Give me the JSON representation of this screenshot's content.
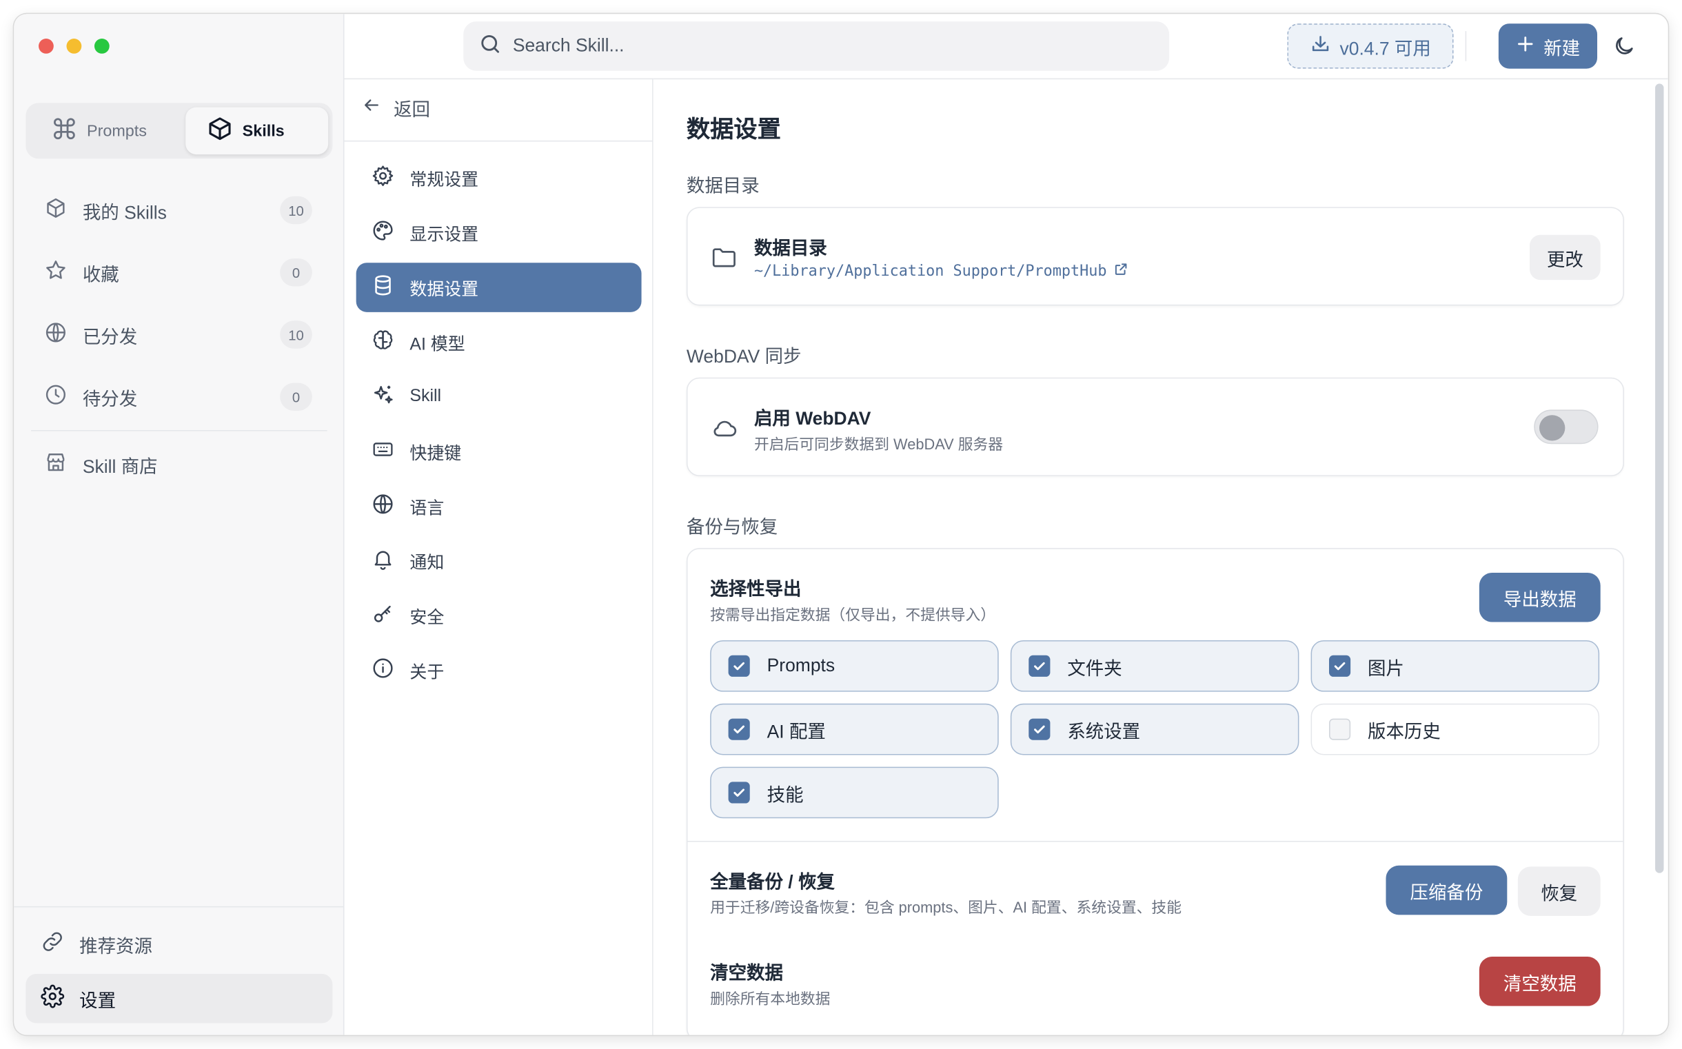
{
  "colors": {
    "accent": "#5477a7",
    "danger": "#b84444",
    "traffic_red": "#ed5f57",
    "traffic_yellow": "#f5bd2f",
    "traffic_green": "#28c840"
  },
  "sidebar": {
    "segment": [
      {
        "label": "Prompts",
        "icon": "command-icon",
        "active": false
      },
      {
        "label": "Skills",
        "icon": "cube-icon",
        "active": true
      }
    ],
    "items": [
      {
        "label": "我的 Skills",
        "count": "10",
        "icon": "cube-icon"
      },
      {
        "label": "收藏",
        "count": "0",
        "icon": "star-icon"
      },
      {
        "label": "已分发",
        "count": "10",
        "icon": "globe-icon"
      },
      {
        "label": "待分发",
        "count": "0",
        "icon": "clock-icon"
      }
    ],
    "store": {
      "label": "Skill 商店",
      "icon": "store-icon"
    },
    "bottom": [
      {
        "label": "推荐资源",
        "icon": "link-icon"
      },
      {
        "label": "设置",
        "icon": "gear-icon",
        "active": true
      }
    ]
  },
  "topbar": {
    "search_placeholder": "Search Skill...",
    "version_label": "v0.4.7 可用",
    "new_label": "新建"
  },
  "settings_menu": {
    "back_label": "返回",
    "items": [
      {
        "label": "常规设置",
        "icon": "gear-icon"
      },
      {
        "label": "显示设置",
        "icon": "palette-icon"
      },
      {
        "label": "数据设置",
        "icon": "database-icon",
        "active": true
      },
      {
        "label": "AI 模型",
        "icon": "brain-icon"
      },
      {
        "label": "Skill",
        "icon": "sparkles-icon"
      },
      {
        "label": "快捷键",
        "icon": "keyboard-icon"
      },
      {
        "label": "语言",
        "icon": "globe-icon"
      },
      {
        "label": "通知",
        "icon": "bell-icon"
      },
      {
        "label": "安全",
        "icon": "key-icon"
      },
      {
        "label": "关于",
        "icon": "info-icon"
      }
    ]
  },
  "content": {
    "page_title": "数据设置",
    "data_dir": {
      "section_title": "数据目录",
      "row_title": "数据目录",
      "path": "~/Library/Application Support/PromptHub",
      "change_label": "更改"
    },
    "webdav": {
      "section_title": "WebDAV 同步",
      "row_title": "启用 WebDAV",
      "row_desc": "开启后可同步数据到 WebDAV 服务器",
      "enabled": false
    },
    "backup": {
      "section_title": "备份与恢复",
      "selective": {
        "title": "选择性导出",
        "desc": "按需导出指定数据（仅导出，不提供导入）",
        "export_label": "导出数据",
        "options": [
          {
            "label": "Prompts",
            "checked": true
          },
          {
            "label": "文件夹",
            "checked": true
          },
          {
            "label": "图片",
            "checked": true
          },
          {
            "label": "AI 配置",
            "checked": true
          },
          {
            "label": "系统设置",
            "checked": true
          },
          {
            "label": "版本历史",
            "checked": false
          },
          {
            "label": "技能",
            "checked": true
          }
        ]
      },
      "full": {
        "title": "全量备份 / 恢复",
        "desc": "用于迁移/跨设备恢复：包含 prompts、图片、AI 配置、系统设置、技能",
        "backup_label": "压缩备份",
        "restore_label": "恢复"
      },
      "clear": {
        "title": "清空数据",
        "desc": "删除所有本地数据",
        "clear_label": "清空数据"
      }
    }
  }
}
